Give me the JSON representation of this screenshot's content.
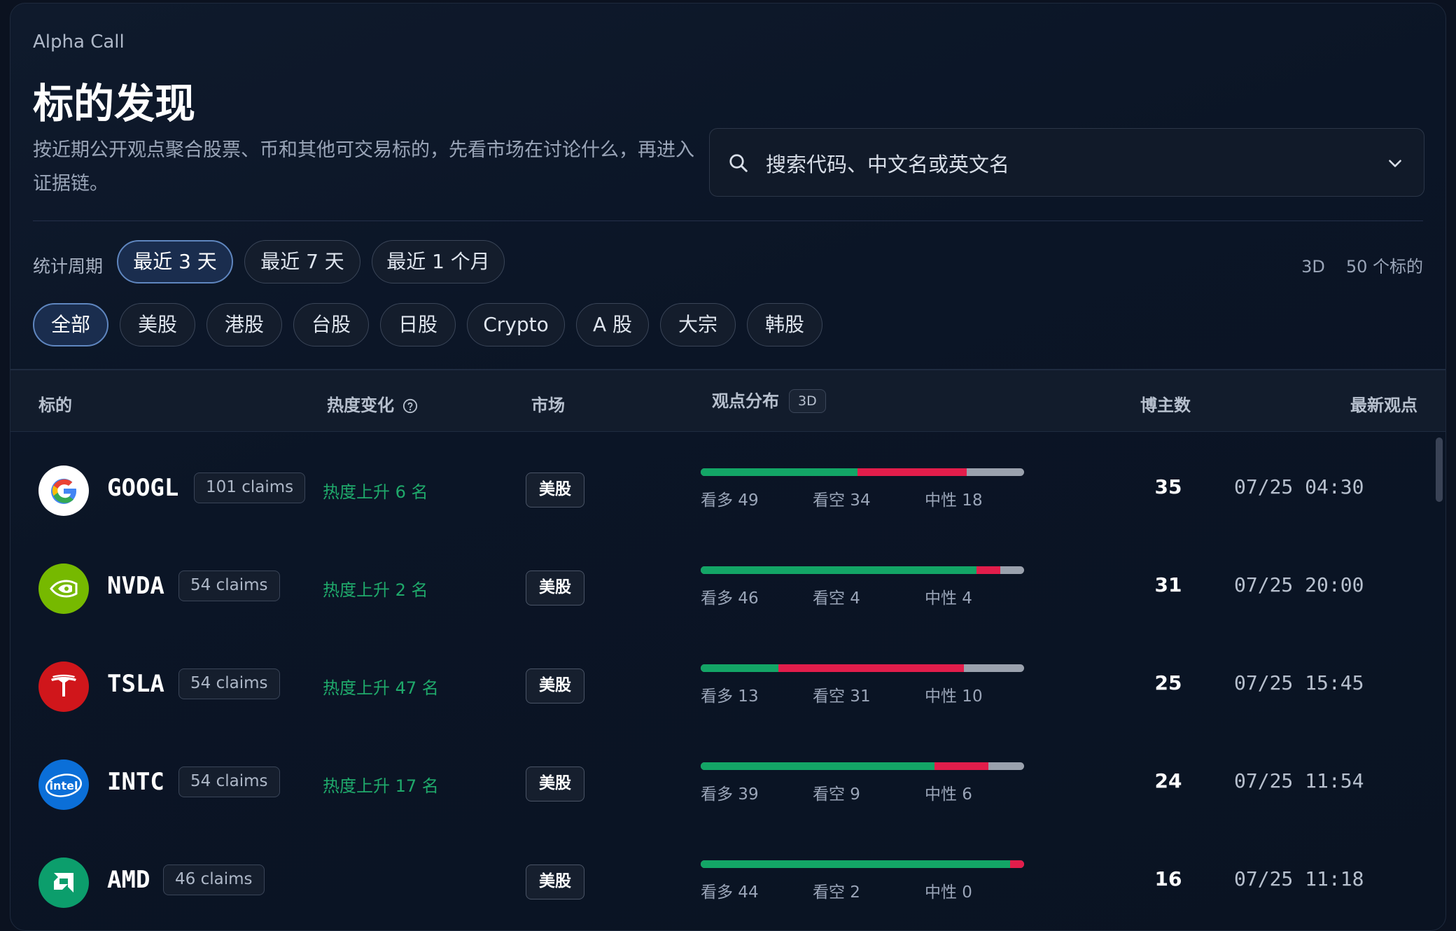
{
  "header": {
    "brand": "Alpha Call",
    "title": "标的发现",
    "description": "按近期公开观点聚合股票、币和其他可交易标的，先看市场在讨论什么，再进入证据链。"
  },
  "search": {
    "placeholder": "搜索代码、中文名或英文名"
  },
  "period": {
    "label": "统计周期",
    "options": [
      "最近 3 天",
      "最近 7 天",
      "最近 1 个月"
    ],
    "active_index": 0,
    "current": "3D",
    "count": "50 个标的"
  },
  "markets": {
    "options": [
      "全部",
      "美股",
      "港股",
      "台股",
      "日股",
      "Crypto",
      "A 股",
      "大宗",
      "韩股"
    ],
    "active_index": 0
  },
  "table": {
    "columns": {
      "asset": "标的",
      "heat": "热度变化",
      "market": "市场",
      "stance": "观点分布",
      "stance_badge": "3D",
      "bloggers": "博主数",
      "latest": "最新观点"
    },
    "rows": [
      {
        "ticker": "GOOGL",
        "claims": "101 claims",
        "heat": "热度上升 6 名",
        "market": "美股",
        "bull": 49,
        "bear": 34,
        "neutral": 18,
        "bull_label": "看多 49",
        "bear_label": "看空 34",
        "neutral_label": "中性 18",
        "bloggers": "35",
        "latest": "07/25 04:30",
        "logo": "google-logo-icon"
      },
      {
        "ticker": "NVDA",
        "claims": "54 claims",
        "heat": "热度上升 2 名",
        "market": "美股",
        "bull": 46,
        "bear": 4,
        "neutral": 4,
        "bull_label": "看多 46",
        "bear_label": "看空 4",
        "neutral_label": "中性 4",
        "bloggers": "31",
        "latest": "07/25 20:00",
        "logo": "nvidia-logo-icon"
      },
      {
        "ticker": "TSLA",
        "claims": "54 claims",
        "heat": "热度上升 47 名",
        "market": "美股",
        "bull": 13,
        "bear": 31,
        "neutral": 10,
        "bull_label": "看多 13",
        "bear_label": "看空 31",
        "neutral_label": "中性 10",
        "bloggers": "25",
        "latest": "07/25 15:45",
        "logo": "tesla-logo-icon"
      },
      {
        "ticker": "INTC",
        "claims": "54 claims",
        "heat": "热度上升 17 名",
        "market": "美股",
        "bull": 39,
        "bear": 9,
        "neutral": 6,
        "bull_label": "看多 39",
        "bear_label": "看空 9",
        "neutral_label": "中性 6",
        "bloggers": "24",
        "latest": "07/25 11:54",
        "logo": "intel-logo-icon"
      },
      {
        "ticker": "AMD",
        "claims": "46 claims",
        "heat": "",
        "market": "美股",
        "bull": 44,
        "bear": 2,
        "neutral": 0,
        "bull_label": "看多 44",
        "bear_label": "看空 2",
        "neutral_label": "中性 0",
        "bloggers": "16",
        "latest": "07/25 11:18",
        "logo": "amd-logo-icon"
      }
    ]
  },
  "colors": {
    "bull": "#13a566",
    "bear": "#e21d4b",
    "neutral": "#9aa1ad",
    "heat_up": "#1fa96b",
    "accent": "#5f86bf"
  }
}
